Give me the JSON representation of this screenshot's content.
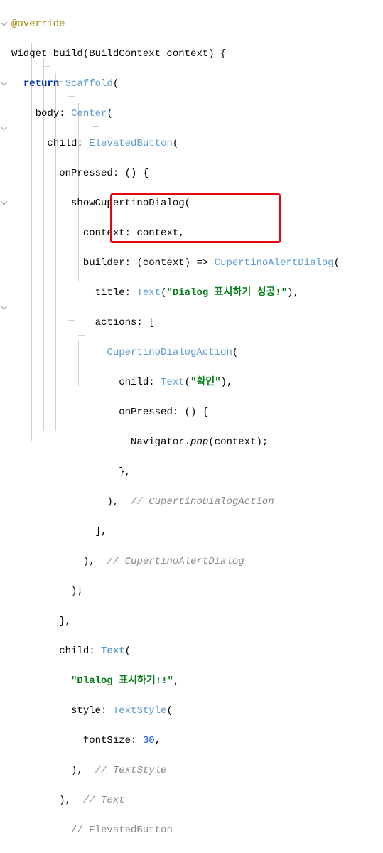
{
  "lines": {
    "l0_anno": "@override",
    "l1_prefix": "Widget build(BuildContext context) {",
    "l2_ret": "return",
    "l2_type": "Scaffold",
    "l2_tail": "(",
    "l3_param": "body:",
    "l3_type": "Center",
    "l3_tail": "(",
    "l4_param": "child:",
    "l4_type": "ElevatedButton",
    "l4_tail": "(",
    "l5_param": "onPressed:",
    "l5_tail": " () {",
    "l6": "showCupertinoDialog(",
    "l7_param": "context:",
    "l7_tail": " context,",
    "l8_param": "builder:",
    "l8_mid": " (context) => ",
    "l8_type": "CupertinoAlertDialog",
    "l8_tail": "(",
    "l9_param": "title:",
    "l9_type": "Text",
    "l9_str": "\"Dialog 표시하기 성공!\"",
    "l9_tail2": "),",
    "l10_param": "actions:",
    "l10_tail": " [",
    "l11_type": "CupertinoDialogAction",
    "l11_tail": "(",
    "l12_param": "child:",
    "l12_type": "Text",
    "l12_str": "\"확인\"",
    "l12_tail2": "),",
    "l13_param": "onPressed:",
    "l13_tail": " () {",
    "l14_a": "Navigator.",
    "l14_b": "pop",
    "l14_c": "(context);",
    "l15": "},",
    "l16_a": "),",
    "l16_c": "  // CupertinoDialogAction",
    "l17": "],",
    "l18_a": "),",
    "l18_c": "  // CupertinoAlertDialog",
    "l19": ");",
    "l20": "},",
    "l21_param": "child:",
    "l21_type": "Text",
    "l21_tail": "(",
    "l22_str": "\"Dlalog 표시하기!!\"",
    "l22_tail": ",",
    "l23_param": "style:",
    "l23_type": "TextStyle",
    "l23_tail": "(",
    "l24_param": "fontSize:",
    "l24_num": "30",
    "l24_tail": ",",
    "l25_a": "),",
    "l25_c": "  // TextStyle",
    "l26_a": "),",
    "l26_c": "  // Text",
    "l27_c": "  // ElevatedButton"
  },
  "indent": {
    "i0": "  ",
    "i1": "    ",
    "i2": "      ",
    "i3": "        ",
    "i4": "          ",
    "i5": "            ",
    "i6": "              ",
    "i7": "                ",
    "i8": "                  ",
    "i9": "                    "
  }
}
